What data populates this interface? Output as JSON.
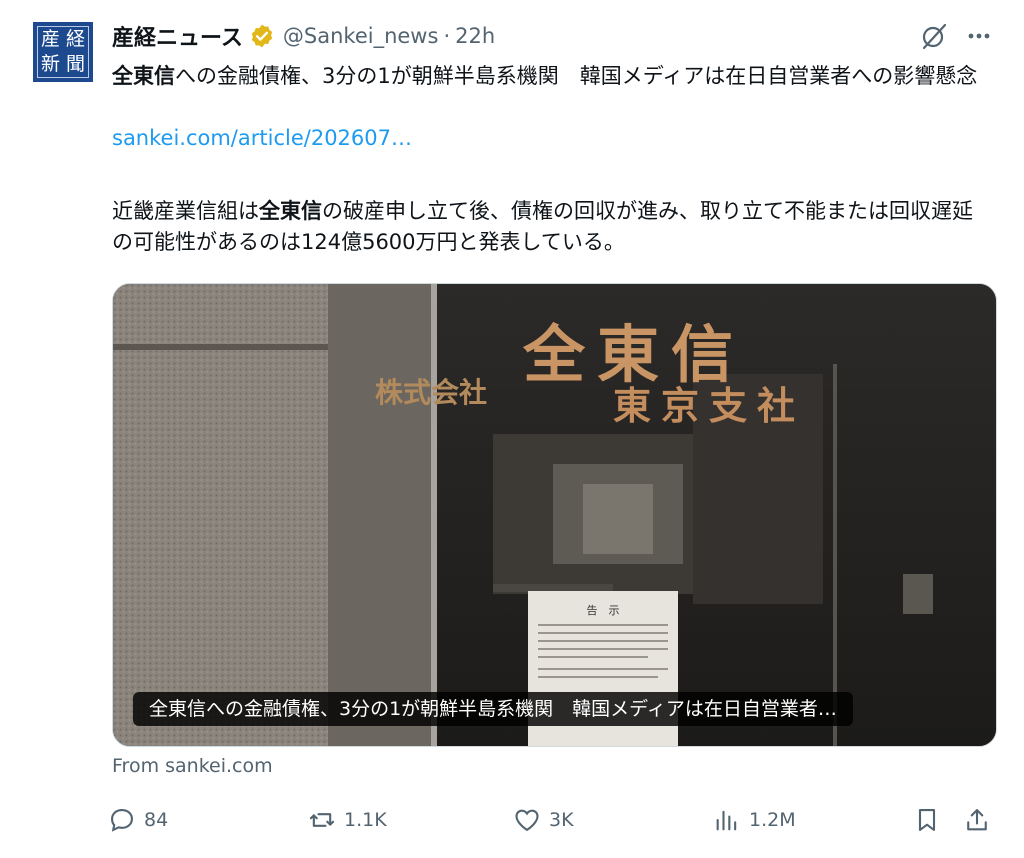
{
  "account": {
    "display_name": "産経ニュース",
    "handle": "@Sankei_news",
    "separator": "·",
    "time": "22h",
    "avatar_chars": [
      "産",
      "経",
      "新",
      "聞"
    ],
    "verified_color": "#e2b719"
  },
  "tweet": {
    "title_bold": "全東信",
    "title_rest": "への金融債権、3分の1が朝鮮半島系機関　韓国メディアは在日自営業者への影響懸念",
    "link": "sankei.com/article/202607…",
    "body_part1": "近畿産業信組は",
    "body_bold": "全東信",
    "body_part2": "の破産申し立て後、債権の回収が進み、取り立て不能または回収遅延の可能性があるのは124億5600万円と発表している。"
  },
  "media": {
    "caption": "全東信への金融債権、3分の1が朝鮮半島系機関　韓国メディアは在日自営業者…",
    "sign_company": "株式会社",
    "sign_name": "全東信",
    "sign_branch": "東京支社",
    "notice_title": "告　示",
    "source": "From sankei.com"
  },
  "actions": {
    "replies": "84",
    "reposts": "1.1K",
    "likes": "3K",
    "views": "1.2M"
  },
  "colors": {
    "link": "#1d9bf0",
    "muted": "#536471",
    "avatar_bg": "#1d4a8f"
  }
}
